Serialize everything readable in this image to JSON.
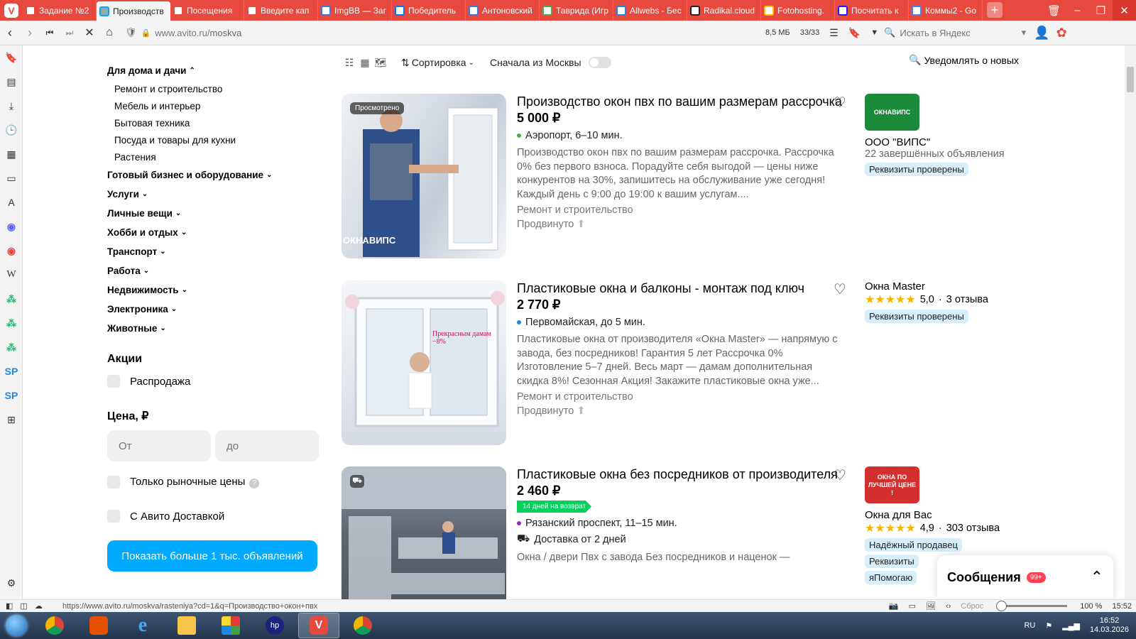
{
  "browser": {
    "tabs": [
      {
        "label": "Задание №2",
        "color": "#e8493f"
      },
      {
        "label": "Производств",
        "color": "#00aaff",
        "active": true
      },
      {
        "label": "Посещения",
        "color": "#e8493f"
      },
      {
        "label": "Введите кап",
        "color": "#e8493f"
      },
      {
        "label": "ImgBB — Заг",
        "color": "#3b7ddd"
      },
      {
        "label": "Победитель",
        "color": "#0077ff"
      },
      {
        "label": "Антоновский",
        "color": "#3b7ddd"
      },
      {
        "label": "Таврида (Игр",
        "color": "#4caf50"
      },
      {
        "label": "Allwebs - Бес",
        "color": "#1e88e5"
      },
      {
        "label": "Radikal.cloud",
        "color": "#222222"
      },
      {
        "label": "Fotohosting.",
        "color": "#ffc107"
      },
      {
        "label": "Посчитать к",
        "color": "#1a1aff"
      },
      {
        "label": "Коммы2 - Go",
        "color": "#4285f4"
      }
    ],
    "url_host": "www.avito.ru/",
    "url_path": "moskva",
    "memory": "8,5 МБ",
    "tab_counter": "33/33",
    "search_placeholder": "Искать в Яндекс"
  },
  "filters": {
    "categories": [
      {
        "label": "Для дома и дачи",
        "expanded": true
      },
      {
        "label": "Готовый бизнес и оборудование"
      },
      {
        "label": "Услуги"
      },
      {
        "label": "Личные вещи"
      },
      {
        "label": "Хобби и отдых"
      },
      {
        "label": "Транспорт"
      },
      {
        "label": "Работа"
      },
      {
        "label": "Недвижимость"
      },
      {
        "label": "Электроника"
      },
      {
        "label": "Животные"
      }
    ],
    "subcategories": [
      "Ремонт и строительство",
      "Мебель и интерьер",
      "Бытовая техника",
      "Посуда и товары для кухни",
      "Растения"
    ],
    "promotions_title": "Акции",
    "sale_label": "Распродажа",
    "price_title": "Цена, ₽",
    "price_from_placeholder": "От",
    "price_to_placeholder": "до",
    "market_price_label": "Только рыночные цены",
    "delivery_label": "С Авито Доставкой",
    "show_more_label": "Показать больше 1 тыс. объявлений"
  },
  "toolbar": {
    "sort_label": "Сортировка",
    "moscow_first_label": "Сначала из Москвы",
    "notify_label": "Уведомлять о новых"
  },
  "listings": [
    {
      "title": "Производство окон пвх по вашим размерам рассрочка",
      "price": "5 000 ₽",
      "viewed_label": "Просмотрено",
      "photo_caption": "ОКНАВИПС",
      "location": "Аэропорт, 6–10 мин.",
      "metro_color": "#4caf50",
      "description": "Производство окон пвх по вашим размерам рассрочка. Рассрочка 0% без первого взноса. Порадуйте себя выгодой — цены ниже конкурентов на 30%, запишитесь на обслуживание уже сегодня! Каждый день с 9:00 до 19:00 к вашим услугам....",
      "category": "Ремонт и строительство",
      "promoted": "Продвинуто",
      "seller": {
        "name": "ООО \"ВИПС\"",
        "meta": "22 завершённых объявления",
        "badge": "Реквизиты проверены",
        "logo_text": "ОКНАВИПС",
        "logo_color": "#1b8a3a"
      }
    },
    {
      "title": "Пластиковые окна и балконы - монтаж под ключ",
      "price": "2 770 ₽",
      "photo_caption": "Прекрасным дамам −8%",
      "location": "Первомайская, до 5 мин.",
      "metro_color": "#1e88e5",
      "description": "Пластиковые окна от производителя «Окна Master» — напрямую с завода, без посредников! Гарантия 5 лет Рассрочка 0% Изготовление 5–7 дней. Весь март — дамам дополнительная скидка 8%! Сезонная Акция! Закажите пластиковые окна уже...",
      "category": "Ремонт и строительство",
      "promoted": "Продвинуто",
      "seller": {
        "name": "Окна Master",
        "rating": "5,0",
        "reviews": "3 отзыва",
        "badge": "Реквизиты проверены"
      }
    },
    {
      "title": "Пластиковые окна без посредников от производителя",
      "price": "2 460 ₽",
      "return_badge": "14 дней на возврат",
      "location": "Рязанский проспект, 11–15 мин.",
      "metro_color": "#9c27b0",
      "delivery": "Доставка от 2 дней",
      "description": "Окна / двери Пвх с завода Без посредников и наценок —",
      "seller": {
        "name": "Окна для Вас",
        "rating": "4,9",
        "reviews": "303 отзыва",
        "badge": "Надёжный продавец",
        "badge2": "Реквизиты",
        "badge3": "яПомогаю",
        "logo_text": "ОКНА ПО ЛУЧШЕЙ ЦЕНЕ !",
        "logo_color": "#d32f2f"
      }
    }
  ],
  "messages": {
    "title": "Сообщения",
    "badge": "99+"
  },
  "statusbar": {
    "link": "https://www.avito.ru/moskva/rasteniya?cd=1&q=Производство+окон+пвх",
    "reset": "Сброс",
    "zoom": "100 %",
    "time": "15:52"
  },
  "taskbar": {
    "lang": "RU",
    "time": "16:52",
    "date": "14.03.2026"
  }
}
